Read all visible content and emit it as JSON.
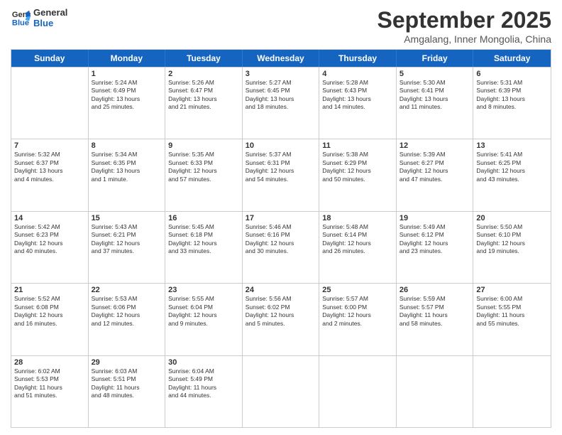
{
  "header": {
    "logo_line1": "General",
    "logo_line2": "Blue",
    "month": "September 2025",
    "location": "Amgalang, Inner Mongolia, China"
  },
  "weekdays": [
    "Sunday",
    "Monday",
    "Tuesday",
    "Wednesday",
    "Thursday",
    "Friday",
    "Saturday"
  ],
  "weeks": [
    [
      {
        "day": "",
        "info": ""
      },
      {
        "day": "1",
        "info": "Sunrise: 5:24 AM\nSunset: 6:49 PM\nDaylight: 13 hours\nand 25 minutes."
      },
      {
        "day": "2",
        "info": "Sunrise: 5:26 AM\nSunset: 6:47 PM\nDaylight: 13 hours\nand 21 minutes."
      },
      {
        "day": "3",
        "info": "Sunrise: 5:27 AM\nSunset: 6:45 PM\nDaylight: 13 hours\nand 18 minutes."
      },
      {
        "day": "4",
        "info": "Sunrise: 5:28 AM\nSunset: 6:43 PM\nDaylight: 13 hours\nand 14 minutes."
      },
      {
        "day": "5",
        "info": "Sunrise: 5:30 AM\nSunset: 6:41 PM\nDaylight: 13 hours\nand 11 minutes."
      },
      {
        "day": "6",
        "info": "Sunrise: 5:31 AM\nSunset: 6:39 PM\nDaylight: 13 hours\nand 8 minutes."
      }
    ],
    [
      {
        "day": "7",
        "info": "Sunrise: 5:32 AM\nSunset: 6:37 PM\nDaylight: 13 hours\nand 4 minutes."
      },
      {
        "day": "8",
        "info": "Sunrise: 5:34 AM\nSunset: 6:35 PM\nDaylight: 13 hours\nand 1 minute."
      },
      {
        "day": "9",
        "info": "Sunrise: 5:35 AM\nSunset: 6:33 PM\nDaylight: 12 hours\nand 57 minutes."
      },
      {
        "day": "10",
        "info": "Sunrise: 5:37 AM\nSunset: 6:31 PM\nDaylight: 12 hours\nand 54 minutes."
      },
      {
        "day": "11",
        "info": "Sunrise: 5:38 AM\nSunset: 6:29 PM\nDaylight: 12 hours\nand 50 minutes."
      },
      {
        "day": "12",
        "info": "Sunrise: 5:39 AM\nSunset: 6:27 PM\nDaylight: 12 hours\nand 47 minutes."
      },
      {
        "day": "13",
        "info": "Sunrise: 5:41 AM\nSunset: 6:25 PM\nDaylight: 12 hours\nand 43 minutes."
      }
    ],
    [
      {
        "day": "14",
        "info": "Sunrise: 5:42 AM\nSunset: 6:23 PM\nDaylight: 12 hours\nand 40 minutes."
      },
      {
        "day": "15",
        "info": "Sunrise: 5:43 AM\nSunset: 6:21 PM\nDaylight: 12 hours\nand 37 minutes."
      },
      {
        "day": "16",
        "info": "Sunrise: 5:45 AM\nSunset: 6:18 PM\nDaylight: 12 hours\nand 33 minutes."
      },
      {
        "day": "17",
        "info": "Sunrise: 5:46 AM\nSunset: 6:16 PM\nDaylight: 12 hours\nand 30 minutes."
      },
      {
        "day": "18",
        "info": "Sunrise: 5:48 AM\nSunset: 6:14 PM\nDaylight: 12 hours\nand 26 minutes."
      },
      {
        "day": "19",
        "info": "Sunrise: 5:49 AM\nSunset: 6:12 PM\nDaylight: 12 hours\nand 23 minutes."
      },
      {
        "day": "20",
        "info": "Sunrise: 5:50 AM\nSunset: 6:10 PM\nDaylight: 12 hours\nand 19 minutes."
      }
    ],
    [
      {
        "day": "21",
        "info": "Sunrise: 5:52 AM\nSunset: 6:08 PM\nDaylight: 12 hours\nand 16 minutes."
      },
      {
        "day": "22",
        "info": "Sunrise: 5:53 AM\nSunset: 6:06 PM\nDaylight: 12 hours\nand 12 minutes."
      },
      {
        "day": "23",
        "info": "Sunrise: 5:55 AM\nSunset: 6:04 PM\nDaylight: 12 hours\nand 9 minutes."
      },
      {
        "day": "24",
        "info": "Sunrise: 5:56 AM\nSunset: 6:02 PM\nDaylight: 12 hours\nand 5 minutes."
      },
      {
        "day": "25",
        "info": "Sunrise: 5:57 AM\nSunset: 6:00 PM\nDaylight: 12 hours\nand 2 minutes."
      },
      {
        "day": "26",
        "info": "Sunrise: 5:59 AM\nSunset: 5:57 PM\nDaylight: 11 hours\nand 58 minutes."
      },
      {
        "day": "27",
        "info": "Sunrise: 6:00 AM\nSunset: 5:55 PM\nDaylight: 11 hours\nand 55 minutes."
      }
    ],
    [
      {
        "day": "28",
        "info": "Sunrise: 6:02 AM\nSunset: 5:53 PM\nDaylight: 11 hours\nand 51 minutes."
      },
      {
        "day": "29",
        "info": "Sunrise: 6:03 AM\nSunset: 5:51 PM\nDaylight: 11 hours\nand 48 minutes."
      },
      {
        "day": "30",
        "info": "Sunrise: 6:04 AM\nSunset: 5:49 PM\nDaylight: 11 hours\nand 44 minutes."
      },
      {
        "day": "",
        "info": ""
      },
      {
        "day": "",
        "info": ""
      },
      {
        "day": "",
        "info": ""
      },
      {
        "day": "",
        "info": ""
      }
    ]
  ]
}
